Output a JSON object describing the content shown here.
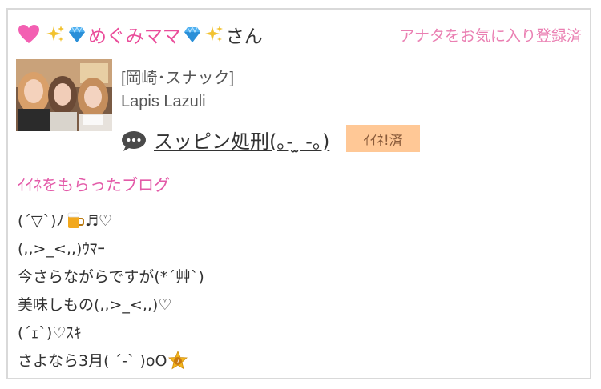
{
  "header": {
    "user_name": "めぐみママ",
    "name_suffix": "さん",
    "favorite_status": "アナタをお気に入り登録済"
  },
  "shop": {
    "category": "[岡崎･スナック]",
    "name": "Lapis Lazuli"
  },
  "post": {
    "title": "スッピン処刑(｡- ̫ -｡)",
    "iine_label": "ｲｲﾈ!済"
  },
  "blog_section": {
    "heading": "ｲｲﾈをもらったブログ",
    "items": [
      {
        "text": "(´▽`)ﾉ",
        "suffix_icons": [
          "beer-icon"
        ],
        "suffix_text": "♬♡"
      },
      {
        "text": "(,,>_<,,)ｳﾏｰ"
      },
      {
        "text": "今さらながらですが(*´艸`)"
      },
      {
        "text": "美味しもの(,,>_<,,)♡"
      },
      {
        "text": "(´ｪ`)♡ｽｷ"
      },
      {
        "text": "さよなら3月( ´-` )oO",
        "suffix_icons": [
          "star-7-icon"
        ]
      }
    ]
  },
  "colors": {
    "pink_text": "#ea4c9a",
    "badge_bg": "#ffc896",
    "border": "#d9d9d9"
  }
}
